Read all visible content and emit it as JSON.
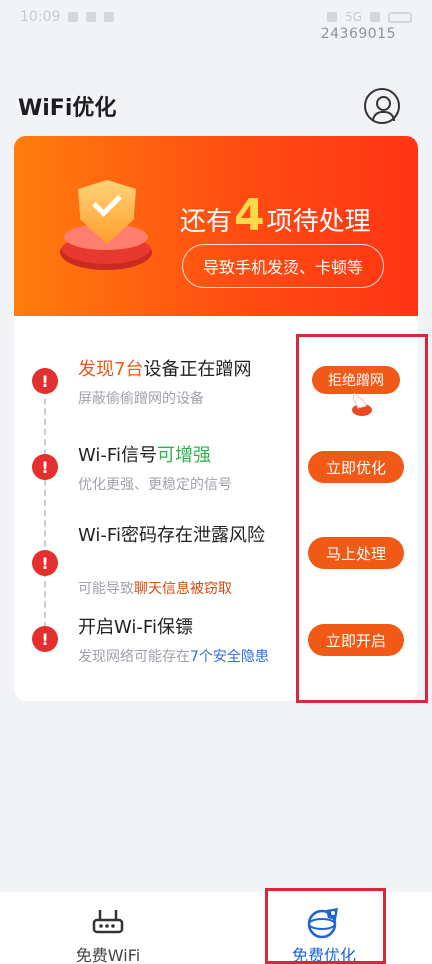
{
  "status_bar": {
    "time": "10:09",
    "network": "5G",
    "battery": ""
  },
  "watermark": "24369015",
  "header": {
    "title": "WiFi优化"
  },
  "banner": {
    "title_prefix": "还有",
    "count": "4",
    "title_suffix": "项待处理",
    "subtitle": "导致手机发烫、卡顿等"
  },
  "issues": [
    {
      "title_highlight": "发现7台",
      "title_rest": "设备正在蹭网",
      "subtitle": "屏蔽偷偷蹭网的设备",
      "button": "拒绝蹭网"
    },
    {
      "title_prefix": "Wi-Fi信号",
      "title_highlight": "可增强",
      "subtitle": "优化更强、更稳定的信号",
      "button": "立即优化"
    },
    {
      "title": "Wi-Fi密码存在泄露风险",
      "subtitle_prefix": "可能导致",
      "subtitle_highlight": "聊天信息被窃取",
      "button": "马上处理"
    },
    {
      "title": "开启Wi-Fi保镖",
      "subtitle_prefix": "发现网络可能存在",
      "subtitle_highlight": "7个安全隐患",
      "button": "立即开启"
    }
  ],
  "tabs": [
    {
      "label": "免费WiFi",
      "icon": "router-icon",
      "active": false
    },
    {
      "label": "免费优化",
      "icon": "rocket-globe-icon",
      "active": true
    }
  ],
  "colors": {
    "accent": "#f05a16",
    "banner_start": "#ff7d0d",
    "banner_end": "#ff3414",
    "alert": "#e3302f",
    "tab_active": "#1e63d8",
    "annotation": "#d8263a"
  }
}
